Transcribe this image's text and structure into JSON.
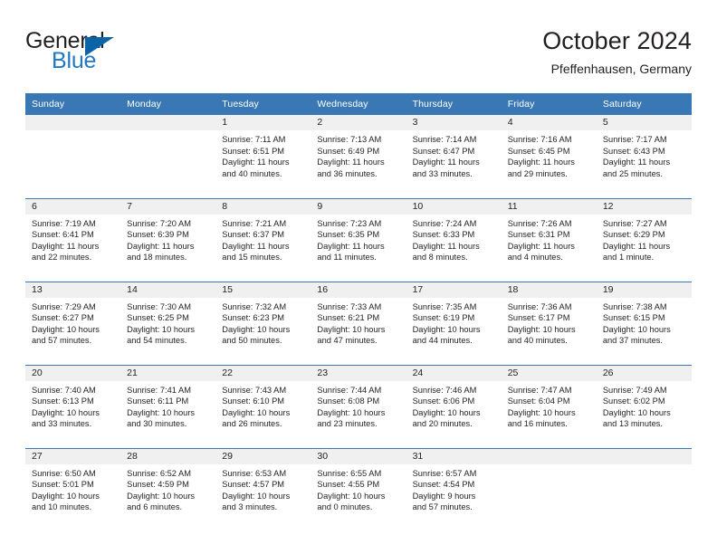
{
  "logo": {
    "word_primary": "General",
    "word_secondary": "Blue",
    "triangle_icon": "triangle-icon",
    "primary_color": "#231f20",
    "secondary_color": "#1f78c1",
    "triangle_color": "#0b64a8"
  },
  "header": {
    "title": "October 2024",
    "subtitle": "Pfeffenhausen, Germany"
  },
  "theme": {
    "header_band": "#3a78b5",
    "daynum_band": "#f0f0f0",
    "text": "#231f20",
    "page_background": "#ffffff"
  },
  "weekday_headers": [
    "Sunday",
    "Monday",
    "Tuesday",
    "Wednesday",
    "Thursday",
    "Friday",
    "Saturday"
  ],
  "weeks": [
    [
      {
        "day": "",
        "lines": []
      },
      {
        "day": "",
        "lines": []
      },
      {
        "day": "1",
        "lines": [
          "Sunrise: 7:11 AM",
          "Sunset: 6:51 PM",
          "Daylight: 11 hours",
          "and 40 minutes."
        ]
      },
      {
        "day": "2",
        "lines": [
          "Sunrise: 7:13 AM",
          "Sunset: 6:49 PM",
          "Daylight: 11 hours",
          "and 36 minutes."
        ]
      },
      {
        "day": "3",
        "lines": [
          "Sunrise: 7:14 AM",
          "Sunset: 6:47 PM",
          "Daylight: 11 hours",
          "and 33 minutes."
        ]
      },
      {
        "day": "4",
        "lines": [
          "Sunrise: 7:16 AM",
          "Sunset: 6:45 PM",
          "Daylight: 11 hours",
          "and 29 minutes."
        ]
      },
      {
        "day": "5",
        "lines": [
          "Sunrise: 7:17 AM",
          "Sunset: 6:43 PM",
          "Daylight: 11 hours",
          "and 25 minutes."
        ]
      }
    ],
    [
      {
        "day": "6",
        "lines": [
          "Sunrise: 7:19 AM",
          "Sunset: 6:41 PM",
          "Daylight: 11 hours",
          "and 22 minutes."
        ]
      },
      {
        "day": "7",
        "lines": [
          "Sunrise: 7:20 AM",
          "Sunset: 6:39 PM",
          "Daylight: 11 hours",
          "and 18 minutes."
        ]
      },
      {
        "day": "8",
        "lines": [
          "Sunrise: 7:21 AM",
          "Sunset: 6:37 PM",
          "Daylight: 11 hours",
          "and 15 minutes."
        ]
      },
      {
        "day": "9",
        "lines": [
          "Sunrise: 7:23 AM",
          "Sunset: 6:35 PM",
          "Daylight: 11 hours",
          "and 11 minutes."
        ]
      },
      {
        "day": "10",
        "lines": [
          "Sunrise: 7:24 AM",
          "Sunset: 6:33 PM",
          "Daylight: 11 hours",
          "and 8 minutes."
        ]
      },
      {
        "day": "11",
        "lines": [
          "Sunrise: 7:26 AM",
          "Sunset: 6:31 PM",
          "Daylight: 11 hours",
          "and 4 minutes."
        ]
      },
      {
        "day": "12",
        "lines": [
          "Sunrise: 7:27 AM",
          "Sunset: 6:29 PM",
          "Daylight: 11 hours",
          "and 1 minute."
        ]
      }
    ],
    [
      {
        "day": "13",
        "lines": [
          "Sunrise: 7:29 AM",
          "Sunset: 6:27 PM",
          "Daylight: 10 hours",
          "and 57 minutes."
        ]
      },
      {
        "day": "14",
        "lines": [
          "Sunrise: 7:30 AM",
          "Sunset: 6:25 PM",
          "Daylight: 10 hours",
          "and 54 minutes."
        ]
      },
      {
        "day": "15",
        "lines": [
          "Sunrise: 7:32 AM",
          "Sunset: 6:23 PM",
          "Daylight: 10 hours",
          "and 50 minutes."
        ]
      },
      {
        "day": "16",
        "lines": [
          "Sunrise: 7:33 AM",
          "Sunset: 6:21 PM",
          "Daylight: 10 hours",
          "and 47 minutes."
        ]
      },
      {
        "day": "17",
        "lines": [
          "Sunrise: 7:35 AM",
          "Sunset: 6:19 PM",
          "Daylight: 10 hours",
          "and 44 minutes."
        ]
      },
      {
        "day": "18",
        "lines": [
          "Sunrise: 7:36 AM",
          "Sunset: 6:17 PM",
          "Daylight: 10 hours",
          "and 40 minutes."
        ]
      },
      {
        "day": "19",
        "lines": [
          "Sunrise: 7:38 AM",
          "Sunset: 6:15 PM",
          "Daylight: 10 hours",
          "and 37 minutes."
        ]
      }
    ],
    [
      {
        "day": "20",
        "lines": [
          "Sunrise: 7:40 AM",
          "Sunset: 6:13 PM",
          "Daylight: 10 hours",
          "and 33 minutes."
        ]
      },
      {
        "day": "21",
        "lines": [
          "Sunrise: 7:41 AM",
          "Sunset: 6:11 PM",
          "Daylight: 10 hours",
          "and 30 minutes."
        ]
      },
      {
        "day": "22",
        "lines": [
          "Sunrise: 7:43 AM",
          "Sunset: 6:10 PM",
          "Daylight: 10 hours",
          "and 26 minutes."
        ]
      },
      {
        "day": "23",
        "lines": [
          "Sunrise: 7:44 AM",
          "Sunset: 6:08 PM",
          "Daylight: 10 hours",
          "and 23 minutes."
        ]
      },
      {
        "day": "24",
        "lines": [
          "Sunrise: 7:46 AM",
          "Sunset: 6:06 PM",
          "Daylight: 10 hours",
          "and 20 minutes."
        ]
      },
      {
        "day": "25",
        "lines": [
          "Sunrise: 7:47 AM",
          "Sunset: 6:04 PM",
          "Daylight: 10 hours",
          "and 16 minutes."
        ]
      },
      {
        "day": "26",
        "lines": [
          "Sunrise: 7:49 AM",
          "Sunset: 6:02 PM",
          "Daylight: 10 hours",
          "and 13 minutes."
        ]
      }
    ],
    [
      {
        "day": "27",
        "lines": [
          "Sunrise: 6:50 AM",
          "Sunset: 5:01 PM",
          "Daylight: 10 hours",
          "and 10 minutes."
        ]
      },
      {
        "day": "28",
        "lines": [
          "Sunrise: 6:52 AM",
          "Sunset: 4:59 PM",
          "Daylight: 10 hours",
          "and 6 minutes."
        ]
      },
      {
        "day": "29",
        "lines": [
          "Sunrise: 6:53 AM",
          "Sunset: 4:57 PM",
          "Daylight: 10 hours",
          "and 3 minutes."
        ]
      },
      {
        "day": "30",
        "lines": [
          "Sunrise: 6:55 AM",
          "Sunset: 4:55 PM",
          "Daylight: 10 hours",
          "and 0 minutes."
        ]
      },
      {
        "day": "31",
        "lines": [
          "Sunrise: 6:57 AM",
          "Sunset: 4:54 PM",
          "Daylight: 9 hours",
          "and 57 minutes."
        ]
      },
      {
        "day": "",
        "lines": []
      },
      {
        "day": "",
        "lines": []
      }
    ]
  ]
}
